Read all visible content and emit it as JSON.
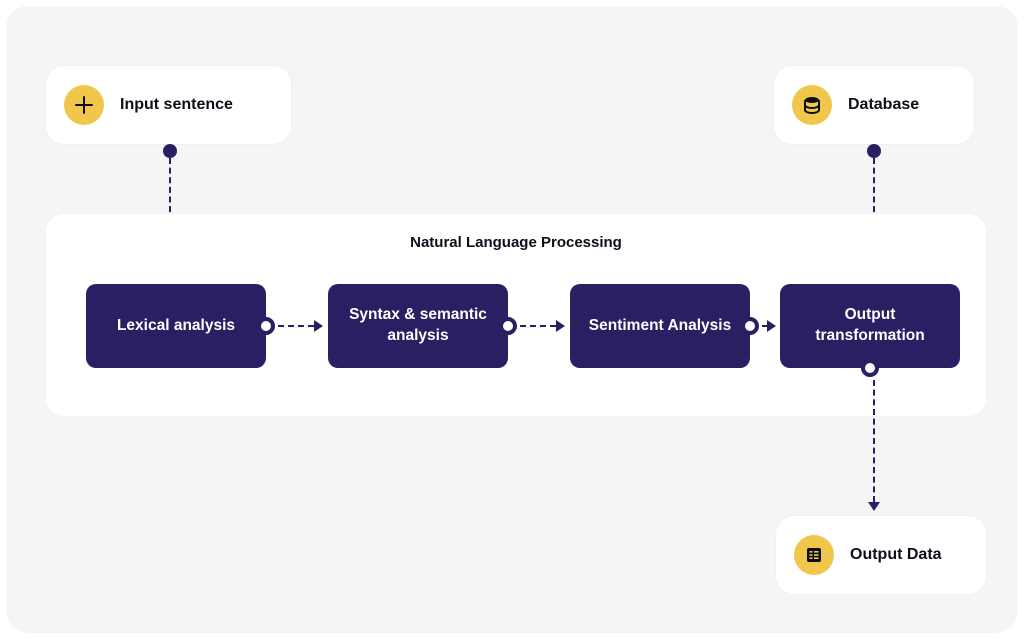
{
  "colors": {
    "bg": "#f5f5f5",
    "card_bg": "#ffffff",
    "accent_yellow": "#f1c74b",
    "node_navy": "#2c1e63",
    "text_dark": "#0e0e19"
  },
  "top_inputs": {
    "input_sentence": {
      "label": "Input sentence",
      "icon": "plus-icon"
    },
    "database": {
      "label": "Database",
      "icon": "database-icon"
    }
  },
  "container": {
    "title": "Natural Language Processing",
    "steps": [
      {
        "label": "Lexical analysis"
      },
      {
        "label": "Syntax & semantic analysis"
      },
      {
        "label": "Sentiment Analysis"
      },
      {
        "label": "Output transformation"
      }
    ]
  },
  "output": {
    "label": "Output Data",
    "icon": "output-data-icon"
  }
}
